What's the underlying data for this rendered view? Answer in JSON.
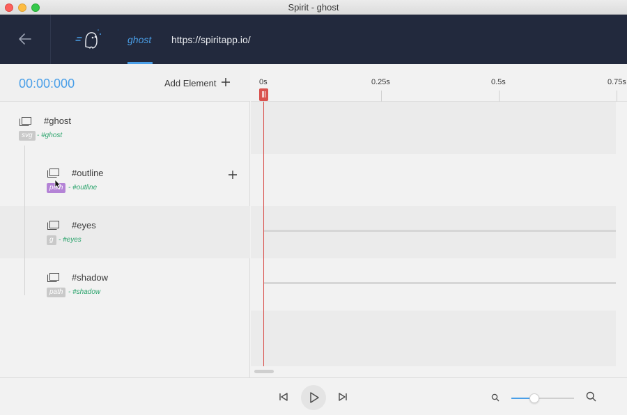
{
  "window": {
    "title": "Spirit - ghost"
  },
  "header": {
    "tabs": [
      {
        "label": "ghost",
        "active": true
      }
    ],
    "url": "https://spiritapp.io/",
    "logo_icon": "ghost-logo-icon",
    "back_icon": "arrow-left-icon"
  },
  "panel": {
    "timecode": "00:00:000",
    "add_element_label": "Add Element"
  },
  "elements": [
    {
      "name": "#ghost",
      "tag": "svg",
      "id": "- #ghost",
      "tag_color": "#c9c9c9"
    },
    {
      "name": "#outline",
      "tag": "path",
      "id": "- #outline",
      "tag_color": "#b483d6"
    },
    {
      "name": "#eyes",
      "tag": "g",
      "id": "- #eyes",
      "tag_color": "#c9c9c9"
    },
    {
      "name": "#shadow",
      "tag": "path",
      "id": "- #shadow",
      "tag_color": "#c9c9c9"
    }
  ],
  "timeline": {
    "ticks": [
      "0s",
      "0.25s",
      "0.5s",
      "0.75s"
    ],
    "playhead_time": "0s"
  },
  "controls": {
    "icons": [
      "skip-back-icon",
      "play-icon",
      "skip-forward-icon",
      "zoom-out-icon",
      "zoom-in-icon"
    ],
    "zoom_level": 0.37
  },
  "colors": {
    "accent": "#4a9fe8",
    "header_bg": "#22293d",
    "playhead": "#d9534f",
    "id_text": "#2aa36b"
  }
}
